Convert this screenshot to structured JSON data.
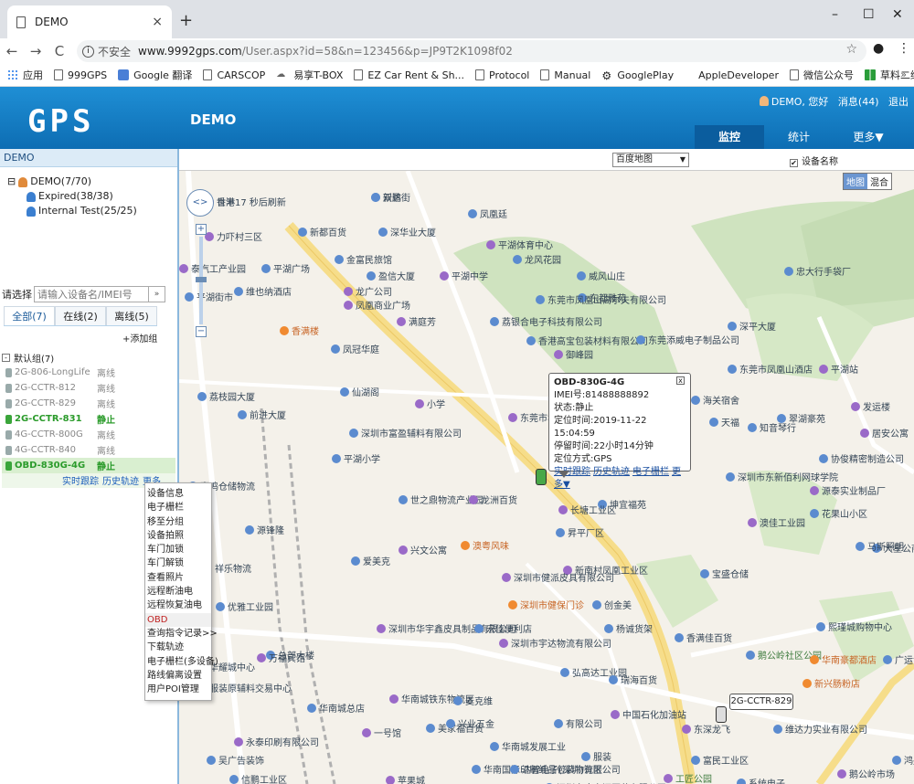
{
  "browser": {
    "tab_title": "DEMO",
    "close": "×",
    "new_tab": "+",
    "min": "–",
    "max": "☐",
    "win_close": "✕",
    "back": "←",
    "forward": "→",
    "reload": "C",
    "not_secure": "不安全",
    "host": "www.9992gps.com",
    "path": "/User.aspx?id=58&n=123456&p=JP9T2K1098f02",
    "star": "☆",
    "more": "⋮"
  },
  "bookmarks": {
    "items": [
      {
        "label": "应用",
        "icon": "apps-icon"
      },
      {
        "label": "999GPS",
        "icon": "page-icon"
      },
      {
        "label": "Google 翻译",
        "icon": "translate-icon"
      },
      {
        "label": "CARSCOP",
        "icon": "page-icon"
      },
      {
        "label": "易享T-BOX",
        "icon": "cloud-icon"
      },
      {
        "label": "EZ Car Rent & Sh...",
        "icon": "page-icon"
      },
      {
        "label": "Protocol",
        "icon": "page-icon"
      },
      {
        "label": "Manual",
        "icon": "page-icon"
      },
      {
        "label": "GooglePlay",
        "icon": "gear-icon"
      },
      {
        "label": "AppleDeveloper",
        "icon": "apple-icon"
      },
      {
        "label": "微信公众号",
        "icon": "page-icon"
      },
      {
        "label": "草料二维码",
        "icon": "qr-icon"
      }
    ],
    "more": "»"
  },
  "header": {
    "logo": "GPS",
    "org": "DEMO",
    "user": "DEMO, 您好",
    "messages": "消息(44)",
    "logout": "退出",
    "tabs": [
      {
        "label": "监控",
        "active": true
      },
      {
        "label": "统计",
        "active": false
      },
      {
        "label": "更多▼",
        "active": false
      }
    ]
  },
  "sidebar": {
    "title": "DEMO",
    "tree": [
      {
        "label": "DEMO(7/70)",
        "toggle": "⊟"
      },
      {
        "label": "Expired(38/38)"
      },
      {
        "label": "Internal Test(25/25)"
      }
    ],
    "select_label": "请选择",
    "search_placeholder": "请输入设备名/IMEI号",
    "dropdown": "»",
    "filter_tabs": [
      "全部(7)",
      "在线(2)",
      "离线(5)"
    ],
    "add_group": "+添加组",
    "group": "默认组(7)",
    "devices": [
      {
        "name": "2G-806-LongLife",
        "status": "离线",
        "online": false
      },
      {
        "name": "2G-CCTR-812",
        "status": "离线",
        "online": false
      },
      {
        "name": "2G-CCTR-829",
        "status": "离线",
        "online": false
      },
      {
        "name": "2G-CCTR-831",
        "status": "静止",
        "online": true
      },
      {
        "name": "4G-CCTR-800G",
        "status": "离线",
        "online": false
      },
      {
        "name": "4G-CCTR-840",
        "status": "离线",
        "online": false
      },
      {
        "name": "OBD-830G-4G",
        "status": "静止",
        "online": true
      }
    ],
    "actions": [
      "实时跟踪",
      "历史轨迹",
      "更多"
    ]
  },
  "context_menu": [
    "设备信息",
    "电子栅栏",
    "移至分组",
    "设备拍照",
    "车门加锁",
    "车门解锁",
    "查看照片",
    "远程断油电",
    "远程恢复油电",
    "OBD",
    "查询指令记录>>",
    "下载轨迹",
    "电子栅栏(多设备)",
    "路线偏离设置",
    "用户POI管理"
  ],
  "map": {
    "provider": "百度地图",
    "show_name": "设备名称",
    "switch": [
      "地图",
      "混合"
    ],
    "popup": {
      "title": "OBD-830G-4G",
      "imei": "IMEI号:81488888892",
      "state": "状态:静止",
      "time": "定位时间:2019-11-22 15:04:59",
      "stay": "停留时间:22小时14分钟",
      "mode": "定位方式:GPS",
      "links": [
        "实时跟踪",
        "历史轨迹",
        "电子栅栏",
        "更多▼"
      ]
    },
    "tag2": "2G-CCTR-829",
    "labels": [
      "世丰17 秒后刷新",
      "双鹏街",
      "凤凰廷",
      "力吓村三区",
      "新都百货",
      "深华业大厦",
      "平湖体育中心",
      "金富民旅馆",
      "龙风花园",
      "泰汽工产业园",
      "平湖广场",
      "盈信大厦",
      "平湖中学",
      "威风山庄",
      "维也纳酒店",
      "龙广公司",
      "东都雅苑",
      "平湖街市",
      "凤凰商业广场",
      "东莞市凤凰山高尔夫有限公司",
      "忠大行手袋厂",
      "满庭芳",
      "荔银合电子科技有限公司",
      "深平大厦",
      "香满楼",
      "凤冠华庭",
      "香港高宝包装材料有限公司",
      "御峰园",
      "东莞添威电子制品公司",
      "东莞市凤凰山酒店",
      "平湖站",
      "荔枝园大厦",
      "仙湖阁",
      "小学",
      "海关宿舍",
      "翠湖豪苑",
      "发运楼",
      "前进大厦",
      "深圳市富盈辅料有限公司",
      "东莞市华实业有限公司",
      "天福",
      "知音琴行",
      "居安公寓",
      "平湖小学",
      "协俊精密制造公司",
      "源泰实业制品厂",
      "嘉鸣仓储物流",
      "世之鼎物流产业园",
      "龙洲百货",
      "坤宜福苑",
      "深圳市东新佰利网球学院",
      "长塘工业区",
      "花果山小区",
      "源锋隆",
      "兴文公寓",
      "澳粤风味",
      "昇平厂区",
      "澳佳工业园",
      "大星公商业中心",
      "爱美克",
      "新南村凤凰工业区",
      "马斯照明",
      "祥乐物流",
      "深圳市健派皮具有限公司",
      "宝盛仓储",
      "优雅工业园",
      "深圳市健保门诊",
      "创金美",
      "熙瑾城购物中心",
      "深圳市华宇鑫皮具制品有限公司",
      "宏佳便利店",
      "杨诚货架",
      "深圳市宇达物流有限公司",
      "香满佳百货",
      "鹅公岭社区公园",
      "华南豪都酒店",
      "总部大楼",
      "华耀城中心",
      "万福宾馆",
      "弘高达工业园",
      "瑞海百货",
      "新兴肠粉店",
      "纺织服装原辅料交易中心",
      "华南城总店",
      "华南城铁东物流区",
      "麦克维",
      "有限公司",
      "中国石化加油站",
      "美家福百货",
      "兴业五金",
      "永泰印刷有限公司",
      "华南城发展工业",
      "服装",
      "一号馆",
      "富民工业区",
      "维达力实业有限公司",
      "鹅公岭市场",
      "吴广告装饰",
      "信鹏工业区",
      "苹果城",
      "华南国际印刷纸品包装物流区",
      "达智电子(深圳)有限公司",
      "工匠公园",
      "深圳市康之源医药有限公司",
      "系统电子",
      "东深龙飞",
      "鸿盛大厦",
      "广运油中心",
      "香港",
      "新达"
    ]
  }
}
